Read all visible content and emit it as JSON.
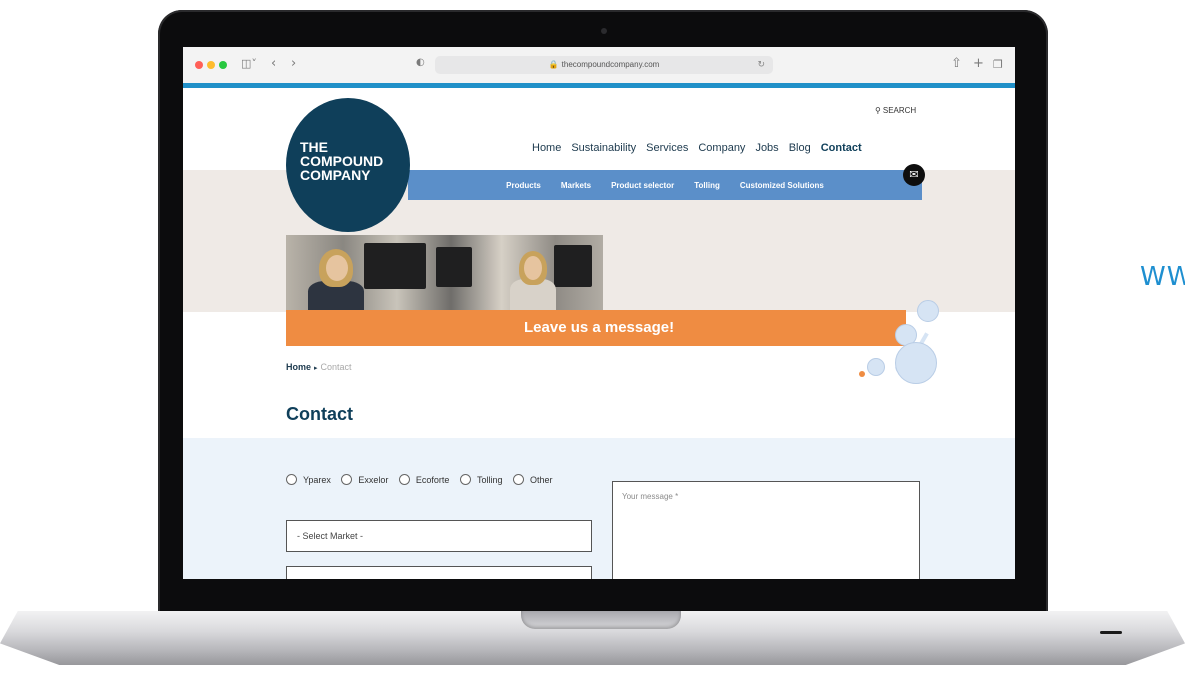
{
  "side_text": "WW",
  "browser": {
    "url": "thecompoundcompany.com",
    "icons": {
      "sidebar": "sidebar-icon",
      "back": "chevron-left-icon",
      "forward": "chevron-right-icon",
      "shield": "shield-icon",
      "lock": "lock-icon",
      "reload": "reload-icon",
      "share": "share-icon",
      "new_tab": "plus-icon",
      "tabs": "tabs-icon"
    },
    "traffic_light_colors": [
      "#ff5f57",
      "#febc2e",
      "#28c840"
    ]
  },
  "logo": {
    "line1": "THE",
    "line2": "COMPOUND",
    "line3": "COMPANY"
  },
  "search_label": "SEARCH",
  "main_nav": [
    "Home",
    "Sustainability",
    "Services",
    "Company",
    "Jobs",
    "Blog",
    "Contact"
  ],
  "active_nav": "Contact",
  "sub_nav": [
    "Products",
    "Markets",
    "Product selector",
    "Tolling",
    "Customized Solutions"
  ],
  "banner_text": "Leave us a message!",
  "breadcrumb": {
    "home": "Home",
    "current": "Contact"
  },
  "page_title": "Contact",
  "form": {
    "radio_options": [
      "Yparex",
      "Exxelor",
      "Ecoforte",
      "Tolling",
      "Other"
    ],
    "select_market": "- Select Market -",
    "message_placeholder": "Your message *"
  },
  "colors": {
    "brand_dark": "#0f3f5a",
    "sub_nav_blue": "#5b8fc9",
    "accent_orange": "#ef8c42",
    "browser_strip": "#2090c8"
  }
}
